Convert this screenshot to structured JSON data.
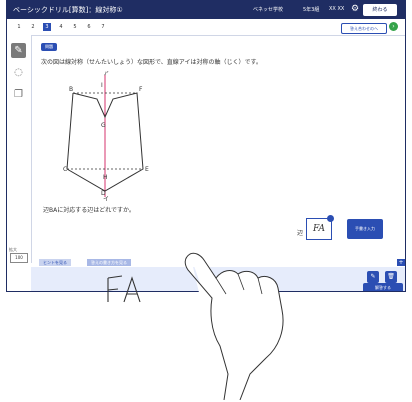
{
  "app": {
    "title": "ベーシックドリル[算数]：線対称①",
    "school": "ベネッセ学校",
    "class": "5年3組",
    "user": "XX XX",
    "end_label": "終わる"
  },
  "pagebar": {
    "pages": [
      "1",
      "2",
      "3",
      "4",
      "5",
      "6",
      "7"
    ],
    "active_index": 2,
    "next_label": "答え合わせのへ",
    "next_icon": "arrow-right-icon"
  },
  "sidebar": {
    "tools": [
      "pen-icon",
      "eraser-icon",
      "copy-icon"
    ],
    "active_tool": "pen-icon",
    "scale_label": "拡大",
    "scale_value": "100"
  },
  "question": {
    "tag": "問題",
    "text": "次の図は線対称（せんたいしょう）な図形で、直線アイは対称の軸（じく）です。",
    "figure_labels": {
      "ア": "ア",
      "イ": "イ",
      "B": "B",
      "C": "C",
      "D": "D",
      "E": "E",
      "F": "F",
      "G": "G",
      "H": "H",
      "I": "I"
    },
    "subquestion": "辺BAに対応する辺はどれですか。",
    "answer_prefix": "辺",
    "answer_value": "FA",
    "input_button": "手書き入力"
  },
  "hints": [
    "ヒントを見る",
    "答えの書き方を見る"
  ],
  "writepad": {
    "handwriting": "FA",
    "answer_button": "解答する",
    "icons": [
      "pen-icon",
      "trash-icon"
    ]
  },
  "colors": {
    "primary": "#2b4eb3",
    "titlebar": "#1f2d63",
    "pad": "#e6ecfb",
    "axis": "#d6336c"
  }
}
